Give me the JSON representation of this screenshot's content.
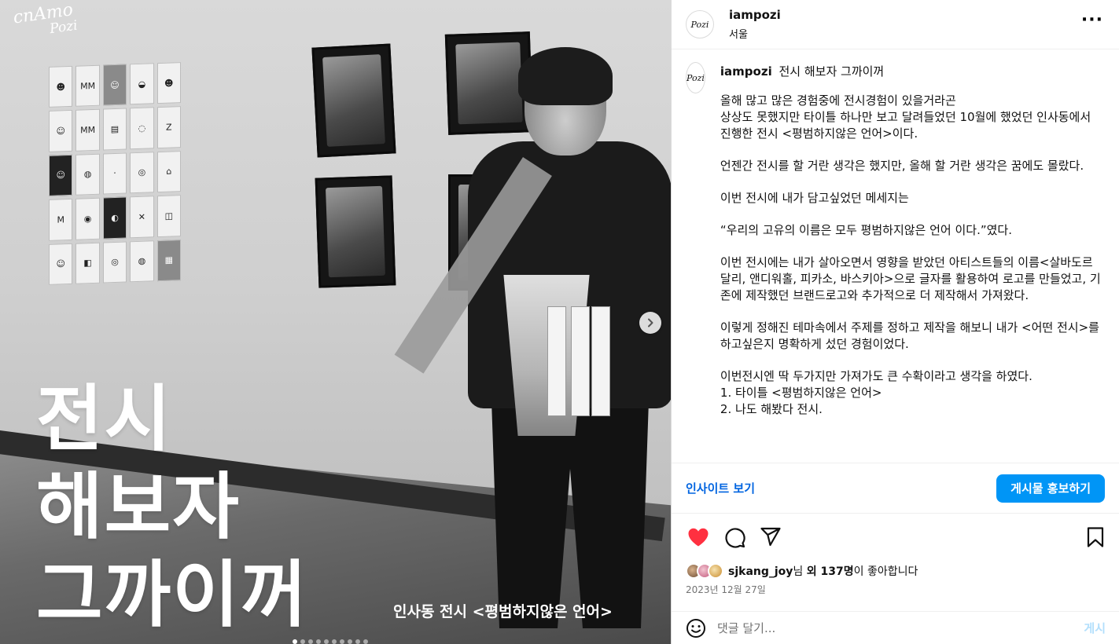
{
  "media": {
    "logo_text": "cnAmo",
    "logo_sub": "Pozi",
    "title_lines": [
      "전시",
      "해보자",
      "그까이꺼"
    ],
    "caption": "인사동 전시 <평범하지않은 언어>",
    "carousel": {
      "total_slides": 10,
      "current_index": 0
    }
  },
  "post": {
    "header": {
      "username": "iampozi",
      "location": "서울",
      "avatar_text": "Pozi"
    },
    "caption": {
      "username": "iampozi",
      "title": "전시 해보자 그까이꺼",
      "paragraphs": [
        "올해 많고 많은 경험중에 전시경험이 있을거라곤\n상상도 못했지만 타이틀 하나만 보고 달려들었던 10월에 했었던 인사동에서 진행한 전시 <평범하지않은 언어>이다.",
        "언젠간 전시를 할 거란 생각은 했지만, 올해 할 거란 생각은 꿈에도 몰랐다.",
        "이번 전시에 내가 담고싶었던 메세지는",
        "“우리의 고유의 이름은 모두 평범하지않은 언어 이다.”였다.",
        "이번 전시에는 내가 살아오면서 영향을 받았던 아티스트들의 이름<살바도르 달리, 앤디워홀, 피카소, 바스키아>으로 글자를 활용하여 로고를 만들었고, 기존에 제작했던 브랜드로고와 추가적으로 더 제작해서 가져왔다.",
        "이렇게 정해진 테마속에서 주제를 정하고 제작을 해보니 내가 <어떤 전시>를 하고싶은지 명확하게 섰던 경험이었다.",
        "이번전시엔 딱 두가지만 가져가도 큰 수확이라고 생각을 하였다.\n1. 타이틀 <평범하지않은 언어>\n2. 나도 해봤다 전시."
      ]
    },
    "insight_link": "인사이트 보기",
    "promote_button": "게시물 홍보하기",
    "likes": {
      "user": "sjkang_joy",
      "suffix_1": "님 ",
      "others": "외 137명",
      "suffix_2": "이 좋아합니다"
    },
    "date": "2023년 12월 27일",
    "comment": {
      "placeholder": "댓글 달기...",
      "post_label": "게시"
    },
    "colors": {
      "like": "#ff3040",
      "accent": "#0095f6",
      "link": "#0064e0"
    }
  }
}
